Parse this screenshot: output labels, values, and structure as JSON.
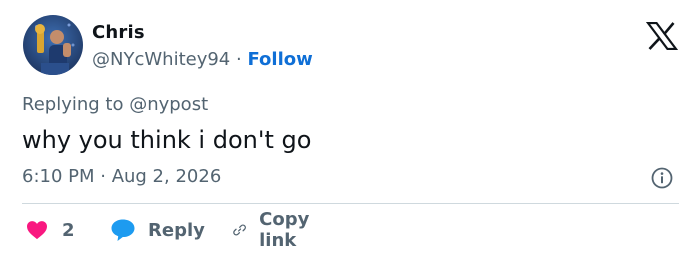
{
  "author": {
    "display_name": "Chris",
    "handle": "@NYcWhitey94",
    "separator": "·",
    "follow_label": "Follow"
  },
  "reply_context": "Replying to @nypost",
  "tweet_text": "why you think i don't go",
  "timestamp": "6:10 PM · Aug 2, 2026",
  "actions": {
    "like_count": "2",
    "reply_label": "Reply",
    "copy_link_label": "Copy link"
  },
  "colors": {
    "like": "#f91880",
    "reply": "#1d9bf0",
    "follow": "#0f6fd6",
    "secondary_text": "#536471"
  },
  "icons": [
    "x-logo-icon",
    "info-icon",
    "heart-icon",
    "speech-bubble-icon",
    "link-icon"
  ]
}
